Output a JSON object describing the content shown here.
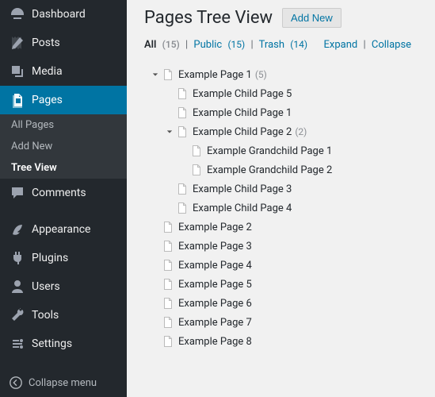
{
  "sidebar": {
    "items": [
      {
        "label": "Dashboard",
        "icon": "dashboard-icon"
      },
      {
        "label": "Posts",
        "icon": "posts-icon"
      },
      {
        "label": "Media",
        "icon": "media-icon"
      },
      {
        "label": "Pages",
        "icon": "pages-icon",
        "current": true
      },
      {
        "label": "Comments",
        "icon": "comments-icon"
      },
      {
        "label": "Appearance",
        "icon": "appearance-icon"
      },
      {
        "label": "Plugins",
        "icon": "plugins-icon"
      },
      {
        "label": "Users",
        "icon": "users-icon"
      },
      {
        "label": "Tools",
        "icon": "tools-icon"
      },
      {
        "label": "Settings",
        "icon": "settings-icon"
      }
    ],
    "submenu": [
      {
        "label": "All Pages"
      },
      {
        "label": "Add New"
      },
      {
        "label": "Tree View",
        "current": true
      }
    ],
    "collapse_label": "Collapse menu"
  },
  "header": {
    "title": "Pages Tree View",
    "add_new": "Add New"
  },
  "filters": {
    "all_label": "All",
    "all_count": "(15)",
    "public_label": "Public",
    "public_count": "(15)",
    "trash_label": "Trash",
    "trash_count": "(14)",
    "expand": "Expand",
    "collapse": "Collapse"
  },
  "tree": {
    "p1": "Example Page 1",
    "p1_count": "(5)",
    "c5": "Example Child Page 5",
    "c1": "Example Child Page 1",
    "c2": "Example Child Page 2",
    "c2_count": "(2)",
    "g1": "Example Grandchild Page 1",
    "g2": "Example Grandchild Page 2",
    "c3": "Example Child Page 3",
    "c4": "Example Child Page 4",
    "p2": "Example Page 2",
    "p3": "Example Page 3",
    "p4": "Example Page 4",
    "p5": "Example Page 5",
    "p6": "Example Page 6",
    "p7": "Example Page 7",
    "p8": "Example Page 8"
  }
}
